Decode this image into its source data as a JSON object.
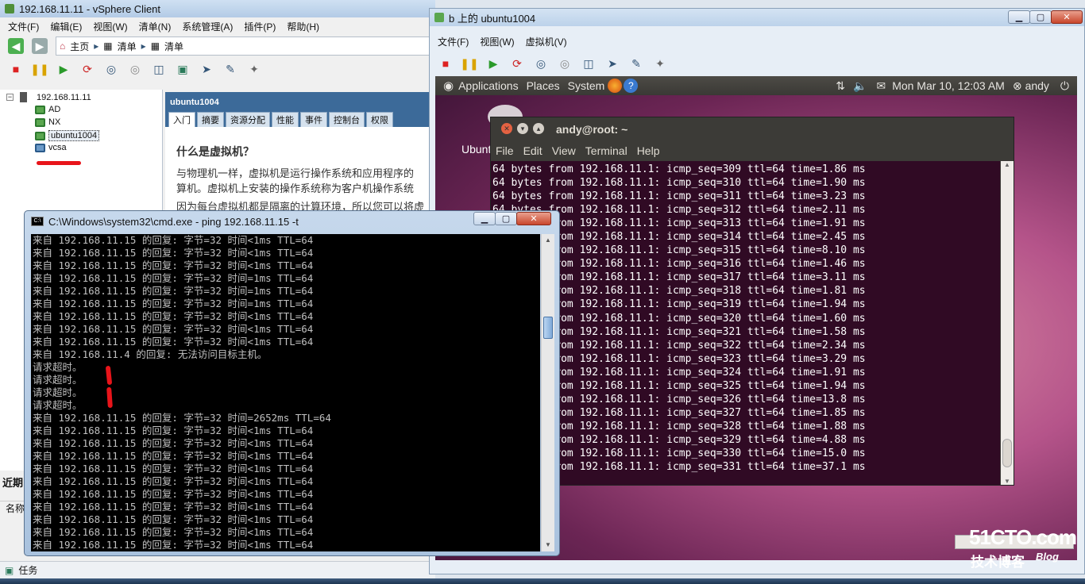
{
  "vsphere": {
    "title": "192.168.11.11 - vSphere Client",
    "menu": [
      "文件(F)",
      "编辑(E)",
      "视图(W)",
      "清单(N)",
      "系统管理(A)",
      "插件(P)",
      "帮助(H)"
    ],
    "nav": {
      "home": "主页",
      "inventory1": "清单",
      "inventory2": "清单"
    },
    "tree": {
      "host": "192.168.11.11",
      "vms": [
        "AD",
        "NX",
        "ubuntu1004",
        "vcsa"
      ],
      "selected": "ubuntu1004"
    },
    "summary": {
      "vm_name": "ubuntu1004",
      "tabs": [
        "入门",
        "摘要",
        "资源分配",
        "性能",
        "事件",
        "控制台",
        "权限"
      ],
      "heading": "什么是虚拟机？",
      "para1": "与物理机一样，虚拟机是运行操作系统和应用程序的",
      "para2": "算机。虚拟机上安装的操作系统称为客户机操作系统",
      "para3": "因为每台虚拟机都是隔离的计算环境，所以您可以将虚"
    },
    "recent_label": "近期",
    "name_col": "名称",
    "status_tasks": "任务"
  },
  "ubuntu_vm": {
    "title": "b 上的 ubuntu1004",
    "menu": [
      "文件(F)",
      "视图(W)",
      "虚拟机(V)"
    ],
    "panel": {
      "applications": "Applications",
      "places": "Places",
      "system": "System",
      "clock": "Mon Mar 10, 12:03 AM",
      "user": "andy"
    },
    "desktop_label": "Ubuntu",
    "terminal": {
      "title": "andy@root: ~",
      "menu": [
        "File",
        "Edit",
        "View",
        "Terminal",
        "Help"
      ],
      "lines": [
        "64 bytes from 192.168.11.1: icmp_seq=309 ttl=64 time=1.86 ms",
        "64 bytes from 192.168.11.1: icmp_seq=310 ttl=64 time=1.90 ms",
        "64 bytes from 192.168.11.1: icmp_seq=311 ttl=64 time=3.23 ms",
        "64 bytes from 192.168.11.1: icmp_seq=312 ttl=64 time=2.11 ms",
        "64 bytes from 192.168.11.1: icmp_seq=313 ttl=64 time=1.91 ms",
        "64 bytes from 192.168.11.1: icmp_seq=314 ttl=64 time=2.45 ms",
        "64 bytes from 192.168.11.1: icmp_seq=315 ttl=64 time=8.10 ms",
        "64 bytes from 192.168.11.1: icmp_seq=316 ttl=64 time=1.46 ms",
        "64 bytes from 192.168.11.1: icmp_seq=317 ttl=64 time=3.11 ms",
        "64 bytes from 192.168.11.1: icmp_seq=318 ttl=64 time=1.81 ms",
        "64 bytes from 192.168.11.1: icmp_seq=319 ttl=64 time=1.94 ms",
        "64 bytes from 192.168.11.1: icmp_seq=320 ttl=64 time=1.60 ms",
        "64 bytes from 192.168.11.1: icmp_seq=321 ttl=64 time=1.58 ms",
        "64 bytes from 192.168.11.1: icmp_seq=322 ttl=64 time=2.34 ms",
        "64 bytes from 192.168.11.1: icmp_seq=323 ttl=64 time=3.29 ms",
        "64 bytes from 192.168.11.1: icmp_seq=324 ttl=64 time=1.91 ms",
        "64 bytes from 192.168.11.1: icmp_seq=325 ttl=64 time=1.94 ms",
        "64 bytes from 192.168.11.1: icmp_seq=326 ttl=64 time=13.8 ms",
        "64 bytes from 192.168.11.1: icmp_seq=327 ttl=64 time=1.85 ms",
        "64 bytes from 192.168.11.1: icmp_seq=328 ttl=64 time=1.88 ms",
        "64 bytes from 192.168.11.1: icmp_seq=329 ttl=64 time=4.88 ms",
        "64 bytes from 192.168.11.1: icmp_seq=330 ttl=64 time=15.0 ms",
        "64 bytes from 192.168.11.1: icmp_seq=331 ttl=64 time=37.1 ms"
      ]
    }
  },
  "cmd": {
    "title": "C:\\Windows\\system32\\cmd.exe - ping  192.168.11.15 -t",
    "lines": [
      "来自 192.168.11.15 的回复: 字节=32 时间<1ms TTL=64",
      "来自 192.168.11.15 的回复: 字节=32 时间<1ms TTL=64",
      "来自 192.168.11.15 的回复: 字节=32 时间<1ms TTL=64",
      "来自 192.168.11.15 的回复: 字节=32 时间=1ms TTL=64",
      "来自 192.168.11.15 的回复: 字节=32 时间=1ms TTL=64",
      "来自 192.168.11.15 的回复: 字节=32 时间=1ms TTL=64",
      "来自 192.168.11.15 的回复: 字节=32 时间<1ms TTL=64",
      "来自 192.168.11.15 的回复: 字节=32 时间<1ms TTL=64",
      "来自 192.168.11.15 的回复: 字节=32 时间<1ms TTL=64",
      "来自 192.168.11.4 的回复: 无法访问目标主机。",
      "请求超时。",
      "请求超时。",
      "请求超时。",
      "请求超时。",
      "来自 192.168.11.15 的回复: 字节=32 时间=2652ms TTL=64",
      "来自 192.168.11.15 的回复: 字节=32 时间<1ms TTL=64",
      "来自 192.168.11.15 的回复: 字节=32 时间<1ms TTL=64",
      "来自 192.168.11.15 的回复: 字节=32 时间<1ms TTL=64",
      "来自 192.168.11.15 的回复: 字节=32 时间<1ms TTL=64",
      "来自 192.168.11.15 的回复: 字节=32 时间<1ms TTL=64",
      "来自 192.168.11.15 的回复: 字节=32 时间<1ms TTL=64",
      "来自 192.168.11.15 的回复: 字节=32 时间<1ms TTL=64",
      "来自 192.168.11.15 的回复: 字节=32 时间<1ms TTL=64",
      "来自 192.168.11.15 的回复: 字节=32 时间<1ms TTL=64",
      "来自 192.168.11.15 的回复: 字节=32 时间<1ms TTL=64"
    ]
  },
  "watermark": {
    "main": "51CTO.com",
    "sub": "技术博客",
    "blog": "Blog"
  }
}
